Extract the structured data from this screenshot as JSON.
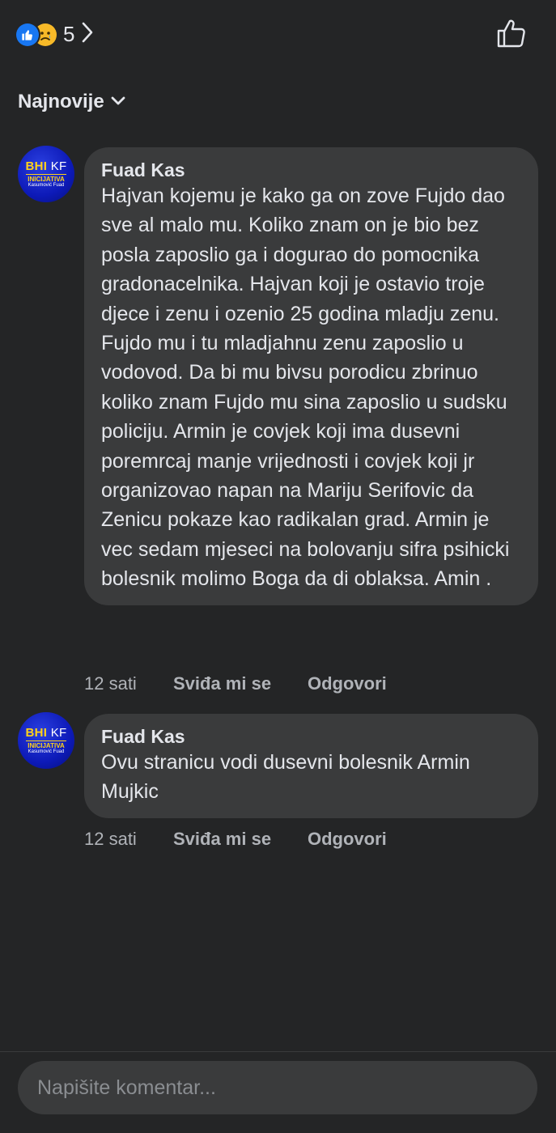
{
  "header": {
    "reaction_icons": [
      "like-icon",
      "sad-icon"
    ],
    "reaction_count": "5",
    "like_icon": "thumbs-up-outline-icon"
  },
  "sort": {
    "label": "Najnovije"
  },
  "comments": [
    {
      "author": "Fuad Kas",
      "avatar_text": {
        "line1": "BHI",
        "line1b": "KF",
        "line2": "INICIJATIVA",
        "line3": "Kasumović Fuad"
      },
      "text": "Hajvan kojemu je kako ga on zove Fujdo dao sve al malo mu. Koliko znam on je bio bez posla zaposlio ga i dogurao do pomocnika gradonacelnika. Hajvan koji je ostavio troje djece i zenu i ozenio 25 godina mladju zenu. Fujdo mu i tu mladjahnu zenu zaposlio u vodovod. Da bi mu bivsu porodicu zbrinuo koliko znam Fujdo mu sina zaposlio u sudsku policiju. Armin je covjek koji ima dusevni poremrcaj manje vrijednosti i covjek koji jr organizovao napan na Mariju Serifovic da Zenicu pokaze kao radikalan grad. Armin je vec sedam mjeseci na bolovanju sifra psihicki bolesnik molimo Boga da di oblaksa. Amin .",
      "time": "12 sati",
      "like_label": "Sviđa mi se",
      "reply_label": "Odgovori"
    },
    {
      "author": "Fuad Kas",
      "avatar_text": {
        "line1": "BHI",
        "line1b": "KF",
        "line2": "INICIJATIVA",
        "line3": "Kasumović Fuad"
      },
      "text": "Ovu stranicu vodi dusevni bolesnik Armin Mujkic",
      "time": "12 sati",
      "like_label": "Sviđa mi se",
      "reply_label": "Odgovori"
    }
  ],
  "composer": {
    "placeholder": "Napišite komentar..."
  },
  "colors": {
    "background": "#242526",
    "bubble": "#3a3b3c",
    "text": "#e4e6eb",
    "secondary_text": "#b0b3b8",
    "like_blue": "#1877f2",
    "sad_yellow": "#f7b928"
  }
}
